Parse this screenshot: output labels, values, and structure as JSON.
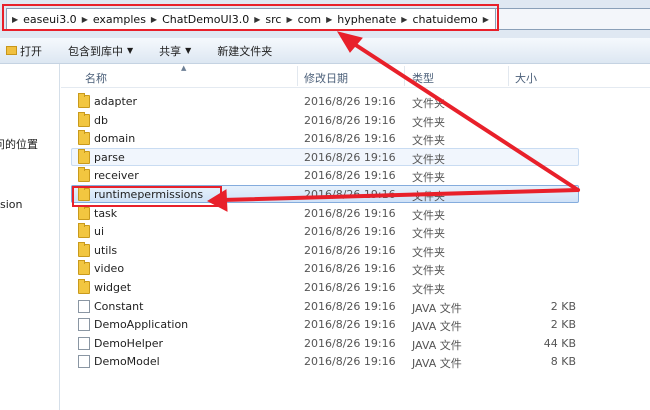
{
  "breadcrumb": [
    "easeui3.0",
    "examples",
    "ChatDemoUI3.0",
    "src",
    "com",
    "hyphenate",
    "chatuidemo"
  ],
  "toolbar": {
    "open": "打开",
    "include_in_library": "包含到库中",
    "share": "共享",
    "new_folder": "新建文件夹"
  },
  "nav_pane": {
    "recent_places_fragment": "问的位置",
    "other_fragment": "sion"
  },
  "columns": {
    "name": "名称",
    "date_modified": "修改日期",
    "type": "类型",
    "size": "大小"
  },
  "files": [
    {
      "name": "adapter",
      "date": "2016/8/26 19:16",
      "type": "文件夹",
      "size": "",
      "kind": "folder"
    },
    {
      "name": "db",
      "date": "2016/8/26 19:16",
      "type": "文件夹",
      "size": "",
      "kind": "folder"
    },
    {
      "name": "domain",
      "date": "2016/8/26 19:16",
      "type": "文件夹",
      "size": "",
      "kind": "folder"
    },
    {
      "name": "parse",
      "date": "2016/8/26 19:16",
      "type": "文件夹",
      "size": "",
      "kind": "folder",
      "state": "hover"
    },
    {
      "name": "receiver",
      "date": "2016/8/26 19:16",
      "type": "文件夹",
      "size": "",
      "kind": "folder"
    },
    {
      "name": "runtimepermissions",
      "date": "2016/8/26 19:16",
      "type": "文件夹",
      "size": "",
      "kind": "folder",
      "state": "selected"
    },
    {
      "name": "task",
      "date": "2016/8/26 19:16",
      "type": "文件夹",
      "size": "",
      "kind": "folder"
    },
    {
      "name": "ui",
      "date": "2016/8/26 19:16",
      "type": "文件夹",
      "size": "",
      "kind": "folder"
    },
    {
      "name": "utils",
      "date": "2016/8/26 19:16",
      "type": "文件夹",
      "size": "",
      "kind": "folder"
    },
    {
      "name": "video",
      "date": "2016/8/26 19:16",
      "type": "文件夹",
      "size": "",
      "kind": "folder"
    },
    {
      "name": "widget",
      "date": "2016/8/26 19:16",
      "type": "文件夹",
      "size": "",
      "kind": "folder"
    },
    {
      "name": "Constant",
      "date": "2016/8/26 19:16",
      "type": "JAVA 文件",
      "size": "2 KB",
      "kind": "file"
    },
    {
      "name": "DemoApplication",
      "date": "2016/8/26 19:16",
      "type": "JAVA 文件",
      "size": "2 KB",
      "kind": "file"
    },
    {
      "name": "DemoHelper",
      "date": "2016/8/26 19:16",
      "type": "JAVA 文件",
      "size": "44 KB",
      "kind": "file"
    },
    {
      "name": "DemoModel",
      "date": "2016/8/26 19:16",
      "type": "JAVA 文件",
      "size": "8 KB",
      "kind": "file"
    }
  ],
  "colors": {
    "annotation": "#e8202a",
    "selection": "#cfe2f7",
    "folder": "#f2c640"
  }
}
